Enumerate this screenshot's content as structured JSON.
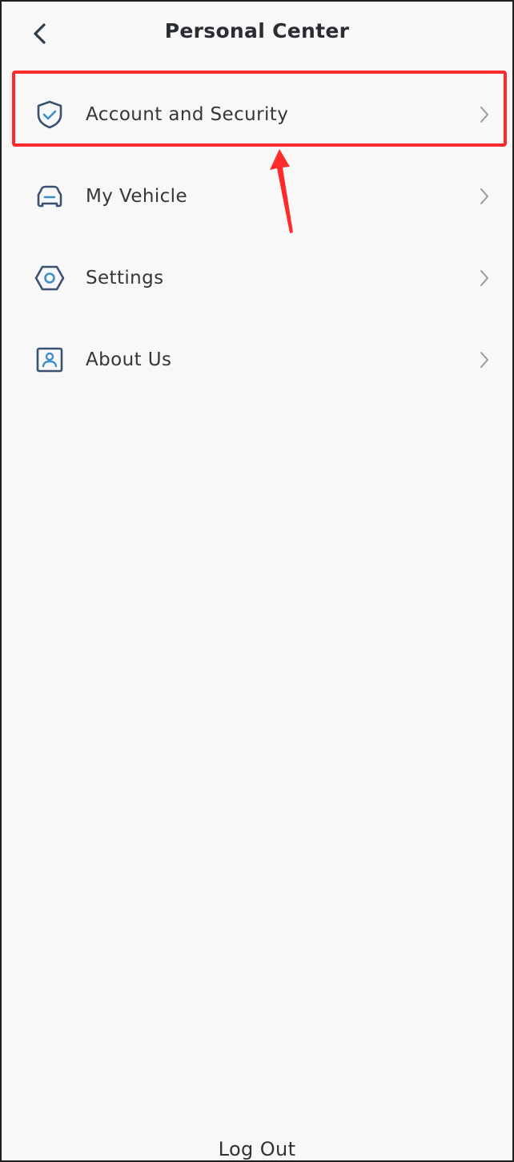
{
  "header": {
    "title": "Personal Center",
    "back_icon": "chevron-left-icon"
  },
  "menu": {
    "items": [
      {
        "label": "Account and Security",
        "icon": "shield-check-icon",
        "highlighted": true
      },
      {
        "label": "My Vehicle",
        "icon": "car-icon",
        "highlighted": false
      },
      {
        "label": "Settings",
        "icon": "hexagon-settings-icon",
        "highlighted": false
      },
      {
        "label": "About Us",
        "icon": "id-card-icon",
        "highlighted": false
      }
    ]
  },
  "footer": {
    "logout_label": "Log Out"
  },
  "colors": {
    "background": "#f8f8f8",
    "text": "#2f3336",
    "icon": "#3a5170",
    "chevron": "#9a9a9a",
    "annotation": "#ff2a2a"
  }
}
